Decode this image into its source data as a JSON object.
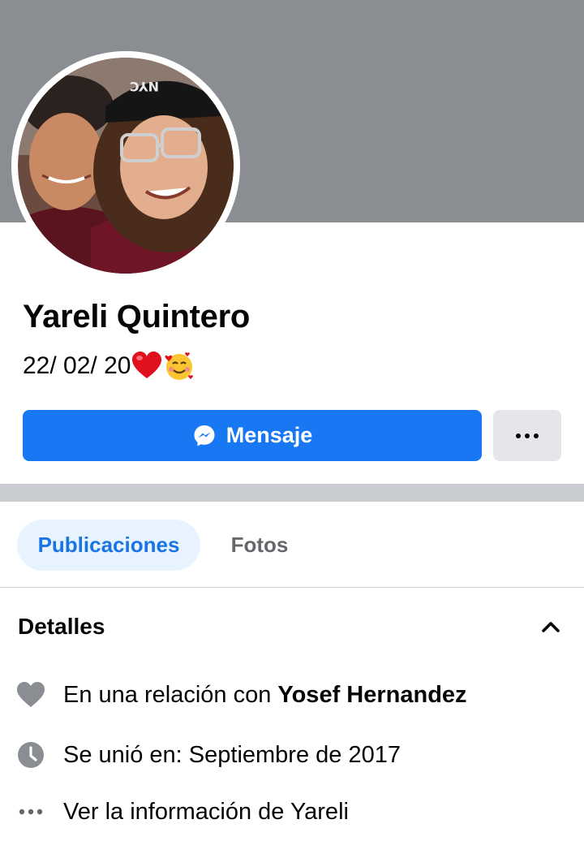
{
  "profile": {
    "name": "Yareli Quintero",
    "bio_text": "22/ 02/ 20",
    "bio_emojis": [
      "red-heart-emoji",
      "smiling-face-with-hearts-emoji"
    ]
  },
  "actions": {
    "message_label": "Mensaje",
    "message_icon": "messenger-icon",
    "more_icon": "more-options-icon",
    "primary_color": "#1877f2"
  },
  "tabs": [
    {
      "label": "Publicaciones",
      "active": true
    },
    {
      "label": "Fotos",
      "active": false
    }
  ],
  "details": {
    "title": "Detalles",
    "collapse_icon": "chevron-up-icon",
    "items": [
      {
        "icon": "heart-icon",
        "text": "En una relación con ",
        "bold": "Yosef Hernandez"
      },
      {
        "icon": "clock-icon",
        "text": "Se unió en: Septiembre de 2017"
      },
      {
        "icon": "more-dots-icon",
        "text": "Ver la información de Yareli"
      }
    ]
  }
}
